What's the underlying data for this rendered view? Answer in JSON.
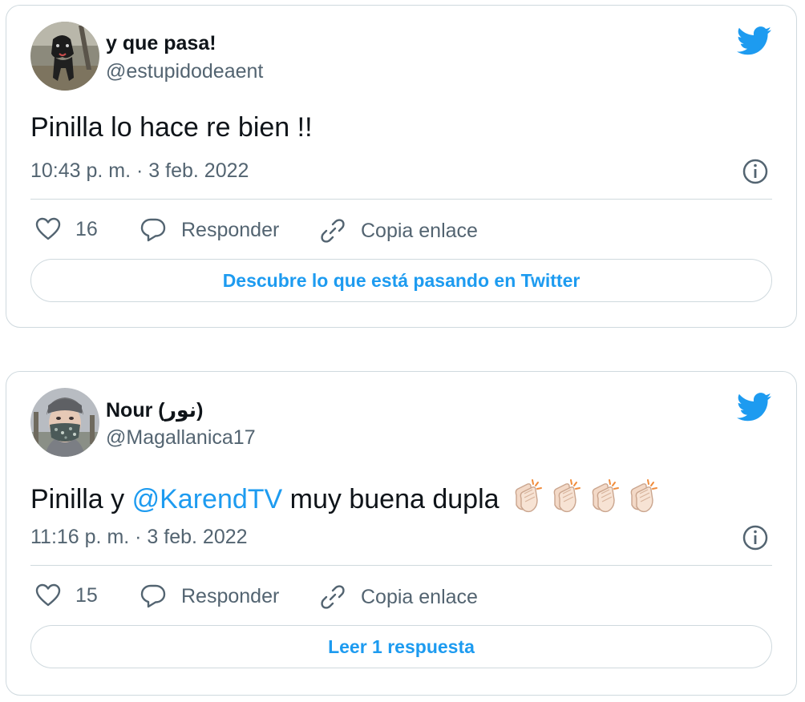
{
  "tweets": [
    {
      "display_name": "y que pasa!",
      "handle": "@estupidodeaent",
      "text": "Pinilla lo hace re bien !!",
      "timestamp": "10:43 p. m. · 3 feb. 2022",
      "likes": "16",
      "reply_label": "Responder",
      "copy_link_label": "Copia enlace",
      "cta_label": "Descubre lo que está pasando en Twitter"
    },
    {
      "display_name": "Nour (نور)",
      "handle": "@Magallanica17",
      "text_before": "Pinilla y ",
      "mention": "@KarendTV",
      "text_after": " muy buena dupla",
      "emoji": "clapping-hands x4",
      "timestamp": "11:16 p. m. · 3 feb. 2022",
      "likes": "15",
      "reply_label": "Responder",
      "copy_link_label": "Copia enlace",
      "cta_label": "Leer 1 respuesta"
    }
  ],
  "colors": {
    "accent": "#1d9bf0",
    "secondary_text": "#536471",
    "border": "#cfd9de"
  },
  "icons": [
    "twitter-bird-icon",
    "heart-icon",
    "reply-bubble-icon",
    "link-icon",
    "info-icon",
    "clapping-hands-emoji"
  ]
}
